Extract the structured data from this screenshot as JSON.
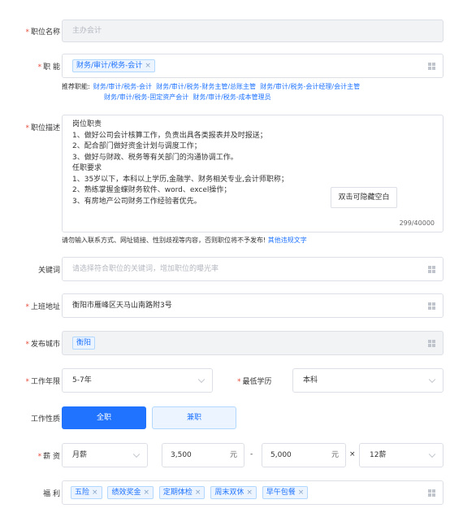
{
  "job_title": {
    "label": "职位名称",
    "value": "主办会计"
  },
  "function": {
    "label": "职 能",
    "tag": "财务/审计/税务-会计",
    "recommend_label": "推荐职能:",
    "recommend_items": [
      "财务/审计/税务-会计",
      "财务/审计/税务-财务主管/总账主管",
      "财务/审计/税务-会计经理/会计主管",
      "财务/审计/税务-固定资产会计",
      "财务/审计/税务-成本管理员"
    ]
  },
  "description": {
    "label": "职位描述",
    "lines": [
      "岗位职责",
      "1、做好公司会计核算工作，负责出具各类报表并及时报送；",
      "2、配合部门做好资金计划与调度工作；",
      "3、做好与财政、税务等有关部门的沟通协调工作。",
      "任职要求",
      "1、35岁以下，本科以上学历,金融学、财务相关专业,会计师职称；",
      "2、熟练掌握金蝶财务软件、word、excel操作；",
      "3、有房地产公司财务工作经验者优先。"
    ],
    "hide_button": "双击可隐藏空白",
    "counter": "299/40000",
    "notice": "请勿输入联系方式、网址链接、性别歧视等内容，否则职位将不予发布!",
    "notice_link": "其他违规文字"
  },
  "keywords": {
    "label": "关键词",
    "placeholder": "请选择符合职位的关键词，增加职位的曝光率"
  },
  "address": {
    "label": "上班地址",
    "value": "衡阳市雁峰区天马山南路附3号"
  },
  "city": {
    "label": "发布城市",
    "tag": "衡阳"
  },
  "experience": {
    "label": "工作年限",
    "value": "5-7年"
  },
  "education": {
    "label": "最低学历",
    "value": "本科"
  },
  "job_type": {
    "label": "工作性质",
    "options": [
      "全职",
      "兼职"
    ],
    "selected": "全职"
  },
  "salary": {
    "label": "薪 资",
    "type": "月薪",
    "min": "3,500",
    "max": "5,000",
    "unit": "元",
    "dash": "-",
    "times": "×",
    "months": "12薪"
  },
  "benefits": {
    "label": "福 利",
    "tags": [
      "五险",
      "绩效奖金",
      "定期体检",
      "周末双休",
      "早午包餐"
    ]
  },
  "colors": {
    "primary": "#1f73ff",
    "required": "#e74c3c",
    "tag_bg": "#ecf5ff"
  }
}
